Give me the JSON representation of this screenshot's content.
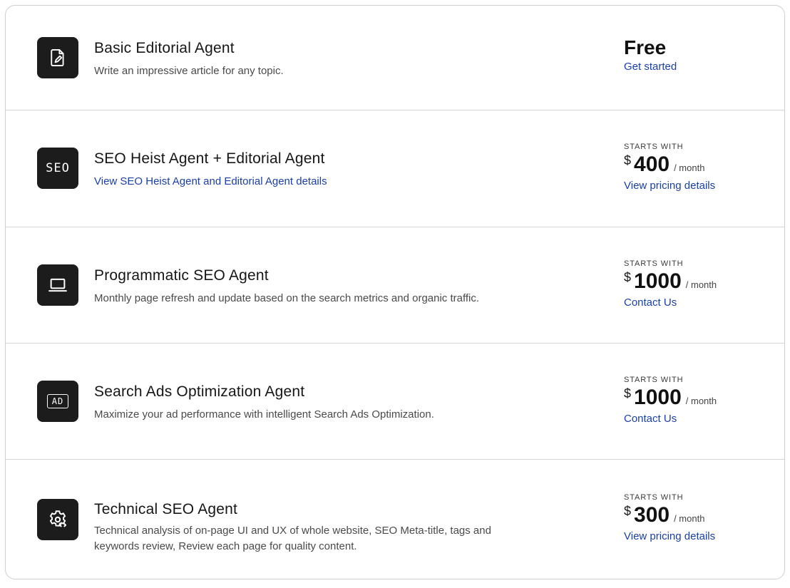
{
  "plans": [
    {
      "icon": "document-edit-icon",
      "title": "Basic Editorial Agent",
      "description": "Write an impressive article for any topic.",
      "price_label": "Free",
      "cta": "Get started"
    },
    {
      "icon": "seo-text-icon",
      "icon_text": "SEO",
      "title": "SEO Heist Agent + Editorial Agent",
      "description_link": "View SEO Heist Agent and Editorial Agent details",
      "starts_with": "STARTS WITH",
      "currency": "$",
      "amount": "400",
      "per": "/ month",
      "cta": "View pricing details"
    },
    {
      "icon": "laptop-icon",
      "title": "Programmatic SEO Agent",
      "description": "Monthly page refresh and update based on the search metrics and organic traffic.",
      "starts_with": "STARTS WITH",
      "currency": "$",
      "amount": "1000",
      "per": "/ month",
      "cta": "Contact Us"
    },
    {
      "icon": "ad-badge-icon",
      "icon_text": "AD",
      "title": "Search Ads Optimization Agent",
      "description": "Maximize your ad performance with intelligent Search Ads Optimization.",
      "starts_with": "STARTS WITH",
      "currency": "$",
      "amount": "1000",
      "per": "/ month",
      "cta": "Contact Us"
    },
    {
      "icon": "gear-code-icon",
      "title": "Technical SEO Agent",
      "description": "Technical analysis of on-page UI and UX of whole website, SEO Meta-title, tags and keywords review, Review each page for quality content.",
      "starts_with": "STARTS WITH",
      "currency": "$",
      "amount": "300",
      "per": "/ month",
      "cta": "View pricing details"
    }
  ],
  "colors": {
    "link": "#1a3fa8",
    "icon_bg": "#1c1c1c",
    "divider": "#d4d4d4"
  }
}
